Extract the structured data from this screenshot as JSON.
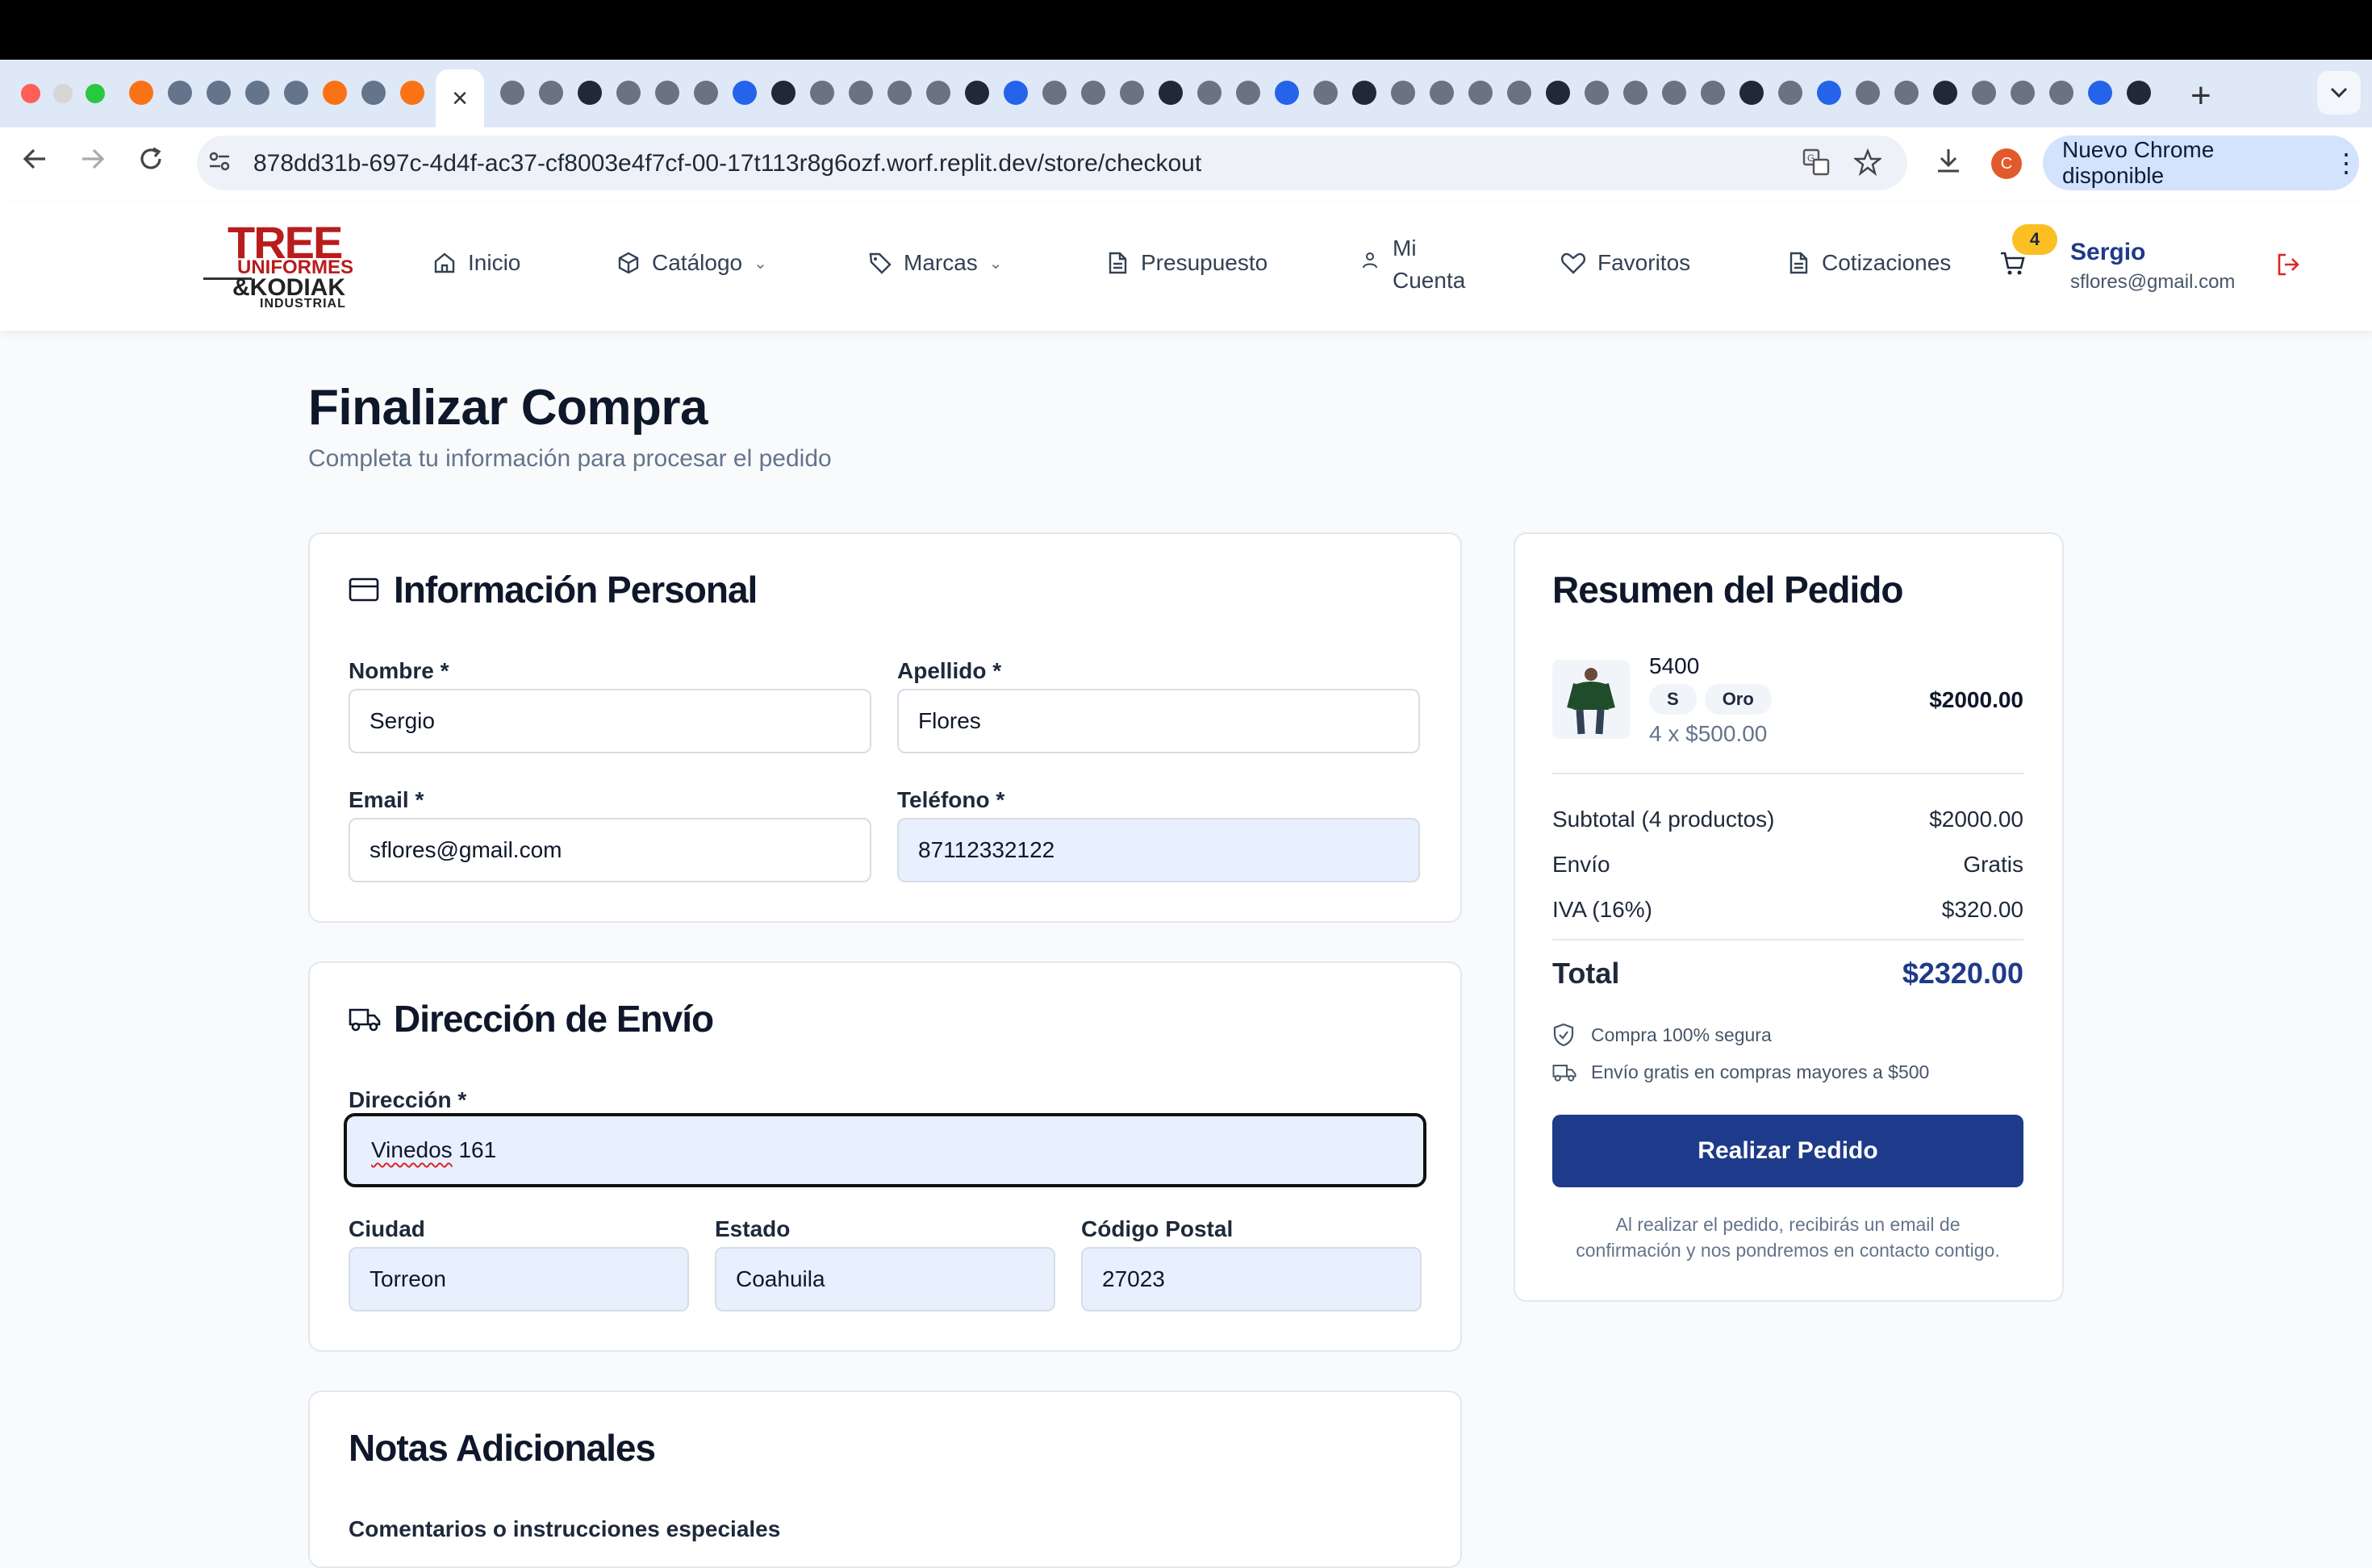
{
  "browser": {
    "url": "878dd31b-697c-4d4f-ac37-cf8003e4f7cf-00-17t113r8g6ozf.worf.replit.dev/store/checkout",
    "update_label": "Nuevo Chrome disponible",
    "profile_initial": "C",
    "active_tab_close": "×",
    "new_tab": "+"
  },
  "header": {
    "logo": {
      "line1": "TREE",
      "line2": "UNIFORMES",
      "line3": "&KODIAK",
      "line4": "INDUSTRIAL"
    },
    "nav": {
      "inicio": "Inicio",
      "catalogo": "Catálogo",
      "marcas": "Marcas",
      "presupuesto": "Presupuesto",
      "mi_cuenta_1": "Mi",
      "mi_cuenta_2": "Cuenta",
      "favoritos": "Favoritos",
      "cotizaciones": "Cotizaciones"
    },
    "cart_count": "4",
    "user": {
      "name": "Sergio",
      "email": "sflores@gmail.com"
    }
  },
  "page": {
    "title": "Finalizar Compra",
    "subtitle": "Completa tu información para procesar el pedido"
  },
  "personal": {
    "title": "Información Personal",
    "nombre_label": "Nombre *",
    "nombre_value": "Sergio",
    "apellido_label": "Apellido *",
    "apellido_value": "Flores",
    "email_label": "Email *",
    "email_value": "sflores@gmail.com",
    "telefono_label": "Teléfono *",
    "telefono_value": "87112332122"
  },
  "shipping": {
    "title": "Dirección de Envío",
    "direccion_label": "Dirección *",
    "direccion_word": "Vinedos",
    "direccion_rest": " 161",
    "ciudad_label": "Ciudad",
    "ciudad_value": "Torreon",
    "estado_label": "Estado",
    "estado_value": "Coahuila",
    "cp_label": "Código Postal",
    "cp_value": "27023"
  },
  "notes": {
    "title": "Notas Adicionales",
    "comments_label": "Comentarios o instrucciones especiales"
  },
  "summary": {
    "title": "Resumen del Pedido",
    "item": {
      "name": "5400",
      "size": "S",
      "color": "Oro",
      "qty_price": "4 x $500.00",
      "total": "$2000.00"
    },
    "subtotal_label": "Subtotal (4 productos)",
    "subtotal_value": "$2000.00",
    "envio_label": "Envío",
    "envio_value": "Gratis",
    "iva_label": "IVA (16%)",
    "iva_value": "$320.00",
    "total_label": "Total",
    "total_value": "$2320.00",
    "secure_note": "Compra 100% segura",
    "free_ship_note": "Envío gratis en compras mayores a $500",
    "cta": "Realizar Pedido",
    "footnote_1": "Al realizar el pedido, recibirás un email de",
    "footnote_2": "confirmación y nos pondremos en contacto contigo."
  },
  "colors": {
    "brand_red": "#b91c1c",
    "primary_blue": "#1e3a8a",
    "cart_badge": "#fbbf24"
  }
}
